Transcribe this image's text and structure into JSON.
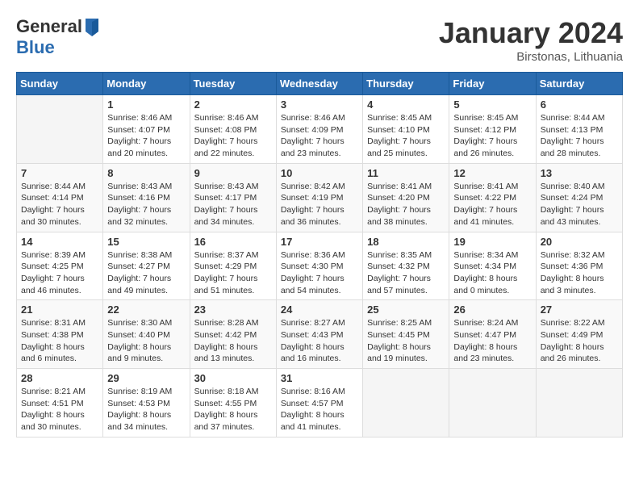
{
  "header": {
    "logo_line1": "General",
    "logo_line2": "Blue",
    "month_title": "January 2024",
    "location": "Birstonas, Lithuania"
  },
  "weekdays": [
    "Sunday",
    "Monday",
    "Tuesday",
    "Wednesday",
    "Thursday",
    "Friday",
    "Saturday"
  ],
  "weeks": [
    [
      {
        "day": "",
        "sunrise": "",
        "sunset": "",
        "daylight": ""
      },
      {
        "day": "1",
        "sunrise": "Sunrise: 8:46 AM",
        "sunset": "Sunset: 4:07 PM",
        "daylight": "Daylight: 7 hours and 20 minutes."
      },
      {
        "day": "2",
        "sunrise": "Sunrise: 8:46 AM",
        "sunset": "Sunset: 4:08 PM",
        "daylight": "Daylight: 7 hours and 22 minutes."
      },
      {
        "day": "3",
        "sunrise": "Sunrise: 8:46 AM",
        "sunset": "Sunset: 4:09 PM",
        "daylight": "Daylight: 7 hours and 23 minutes."
      },
      {
        "day": "4",
        "sunrise": "Sunrise: 8:45 AM",
        "sunset": "Sunset: 4:10 PM",
        "daylight": "Daylight: 7 hours and 25 minutes."
      },
      {
        "day": "5",
        "sunrise": "Sunrise: 8:45 AM",
        "sunset": "Sunset: 4:12 PM",
        "daylight": "Daylight: 7 hours and 26 minutes."
      },
      {
        "day": "6",
        "sunrise": "Sunrise: 8:44 AM",
        "sunset": "Sunset: 4:13 PM",
        "daylight": "Daylight: 7 hours and 28 minutes."
      }
    ],
    [
      {
        "day": "7",
        "sunrise": "Sunrise: 8:44 AM",
        "sunset": "Sunset: 4:14 PM",
        "daylight": "Daylight: 7 hours and 30 minutes."
      },
      {
        "day": "8",
        "sunrise": "Sunrise: 8:43 AM",
        "sunset": "Sunset: 4:16 PM",
        "daylight": "Daylight: 7 hours and 32 minutes."
      },
      {
        "day": "9",
        "sunrise": "Sunrise: 8:43 AM",
        "sunset": "Sunset: 4:17 PM",
        "daylight": "Daylight: 7 hours and 34 minutes."
      },
      {
        "day": "10",
        "sunrise": "Sunrise: 8:42 AM",
        "sunset": "Sunset: 4:19 PM",
        "daylight": "Daylight: 7 hours and 36 minutes."
      },
      {
        "day": "11",
        "sunrise": "Sunrise: 8:41 AM",
        "sunset": "Sunset: 4:20 PM",
        "daylight": "Daylight: 7 hours and 38 minutes."
      },
      {
        "day": "12",
        "sunrise": "Sunrise: 8:41 AM",
        "sunset": "Sunset: 4:22 PM",
        "daylight": "Daylight: 7 hours and 41 minutes."
      },
      {
        "day": "13",
        "sunrise": "Sunrise: 8:40 AM",
        "sunset": "Sunset: 4:24 PM",
        "daylight": "Daylight: 7 hours and 43 minutes."
      }
    ],
    [
      {
        "day": "14",
        "sunrise": "Sunrise: 8:39 AM",
        "sunset": "Sunset: 4:25 PM",
        "daylight": "Daylight: 7 hours and 46 minutes."
      },
      {
        "day": "15",
        "sunrise": "Sunrise: 8:38 AM",
        "sunset": "Sunset: 4:27 PM",
        "daylight": "Daylight: 7 hours and 49 minutes."
      },
      {
        "day": "16",
        "sunrise": "Sunrise: 8:37 AM",
        "sunset": "Sunset: 4:29 PM",
        "daylight": "Daylight: 7 hours and 51 minutes."
      },
      {
        "day": "17",
        "sunrise": "Sunrise: 8:36 AM",
        "sunset": "Sunset: 4:30 PM",
        "daylight": "Daylight: 7 hours and 54 minutes."
      },
      {
        "day": "18",
        "sunrise": "Sunrise: 8:35 AM",
        "sunset": "Sunset: 4:32 PM",
        "daylight": "Daylight: 7 hours and 57 minutes."
      },
      {
        "day": "19",
        "sunrise": "Sunrise: 8:34 AM",
        "sunset": "Sunset: 4:34 PM",
        "daylight": "Daylight: 8 hours and 0 minutes."
      },
      {
        "day": "20",
        "sunrise": "Sunrise: 8:32 AM",
        "sunset": "Sunset: 4:36 PM",
        "daylight": "Daylight: 8 hours and 3 minutes."
      }
    ],
    [
      {
        "day": "21",
        "sunrise": "Sunrise: 8:31 AM",
        "sunset": "Sunset: 4:38 PM",
        "daylight": "Daylight: 8 hours and 6 minutes."
      },
      {
        "day": "22",
        "sunrise": "Sunrise: 8:30 AM",
        "sunset": "Sunset: 4:40 PM",
        "daylight": "Daylight: 8 hours and 9 minutes."
      },
      {
        "day": "23",
        "sunrise": "Sunrise: 8:28 AM",
        "sunset": "Sunset: 4:42 PM",
        "daylight": "Daylight: 8 hours and 13 minutes."
      },
      {
        "day": "24",
        "sunrise": "Sunrise: 8:27 AM",
        "sunset": "Sunset: 4:43 PM",
        "daylight": "Daylight: 8 hours and 16 minutes."
      },
      {
        "day": "25",
        "sunrise": "Sunrise: 8:25 AM",
        "sunset": "Sunset: 4:45 PM",
        "daylight": "Daylight: 8 hours and 19 minutes."
      },
      {
        "day": "26",
        "sunrise": "Sunrise: 8:24 AM",
        "sunset": "Sunset: 4:47 PM",
        "daylight": "Daylight: 8 hours and 23 minutes."
      },
      {
        "day": "27",
        "sunrise": "Sunrise: 8:22 AM",
        "sunset": "Sunset: 4:49 PM",
        "daylight": "Daylight: 8 hours and 26 minutes."
      }
    ],
    [
      {
        "day": "28",
        "sunrise": "Sunrise: 8:21 AM",
        "sunset": "Sunset: 4:51 PM",
        "daylight": "Daylight: 8 hours and 30 minutes."
      },
      {
        "day": "29",
        "sunrise": "Sunrise: 8:19 AM",
        "sunset": "Sunset: 4:53 PM",
        "daylight": "Daylight: 8 hours and 34 minutes."
      },
      {
        "day": "30",
        "sunrise": "Sunrise: 8:18 AM",
        "sunset": "Sunset: 4:55 PM",
        "daylight": "Daylight: 8 hours and 37 minutes."
      },
      {
        "day": "31",
        "sunrise": "Sunrise: 8:16 AM",
        "sunset": "Sunset: 4:57 PM",
        "daylight": "Daylight: 8 hours and 41 minutes."
      },
      {
        "day": "",
        "sunrise": "",
        "sunset": "",
        "daylight": ""
      },
      {
        "day": "",
        "sunrise": "",
        "sunset": "",
        "daylight": ""
      },
      {
        "day": "",
        "sunrise": "",
        "sunset": "",
        "daylight": ""
      }
    ]
  ]
}
